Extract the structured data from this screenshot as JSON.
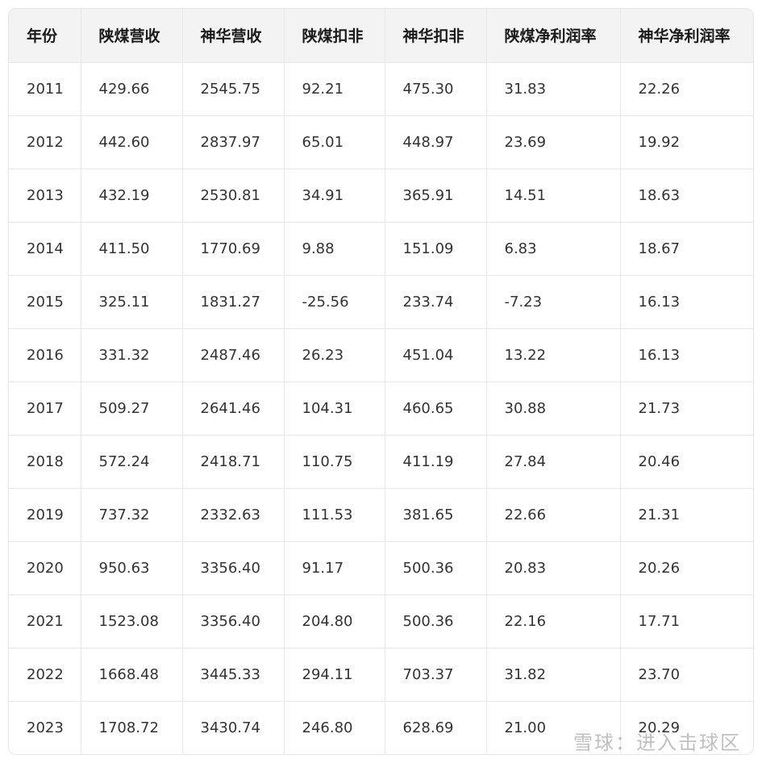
{
  "table": {
    "headers": [
      "年份",
      "陕煤营收",
      "神华营收",
      "陕煤扣非",
      "神华扣非",
      "陕煤净利润率",
      "神华净利润率"
    ],
    "rows": [
      [
        "2011",
        "429.66",
        "2545.75",
        "92.21",
        "475.30",
        "31.83",
        "22.26"
      ],
      [
        "2012",
        "442.60",
        "2837.97",
        "65.01",
        "448.97",
        "23.69",
        "19.92"
      ],
      [
        "2013",
        "432.19",
        "2530.81",
        "34.91",
        "365.91",
        "14.51",
        "18.63"
      ],
      [
        "2014",
        "411.50",
        "1770.69",
        "9.88",
        "151.09",
        "6.83",
        "18.67"
      ],
      [
        "2015",
        "325.11",
        "1831.27",
        "-25.56",
        "233.74",
        "-7.23",
        "16.13"
      ],
      [
        "2016",
        "331.32",
        "2487.46",
        "26.23",
        "451.04",
        "13.22",
        "16.13"
      ],
      [
        "2017",
        "509.27",
        "2641.46",
        "104.31",
        "460.65",
        "30.88",
        "21.73"
      ],
      [
        "2018",
        "572.24",
        "2418.71",
        "110.75",
        "411.19",
        "27.84",
        "20.46"
      ],
      [
        "2019",
        "737.32",
        "2332.63",
        "111.53",
        "381.65",
        "22.66",
        "21.31"
      ],
      [
        "2020",
        "950.63",
        "3356.40",
        "91.17",
        "500.36",
        "20.83",
        "20.26"
      ],
      [
        "2021",
        "1523.08",
        "3356.40",
        "204.80",
        "500.36",
        "22.16",
        "17.71"
      ],
      [
        "2022",
        "1668.48",
        "3445.33",
        "294.11",
        "703.37",
        "31.82",
        "23.70"
      ],
      [
        "2023",
        "1708.72",
        "3430.74",
        "246.80",
        "628.69",
        "21.00",
        "20.29"
      ]
    ]
  },
  "watermark": {
    "text": "雪球：进入击球区"
  }
}
